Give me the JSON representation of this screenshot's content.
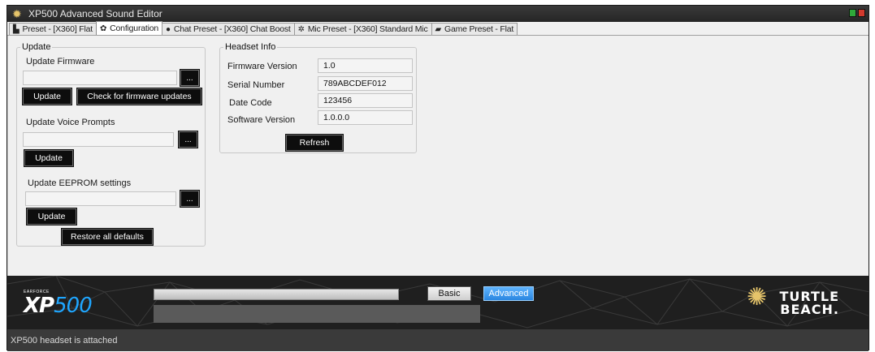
{
  "window": {
    "title": "XP500 Advanced Sound Editor",
    "icon": "turtle-beach-star-icon"
  },
  "tabs": [
    {
      "label": "Preset - [X360] Flat",
      "icon": "equalizer-icon",
      "active": false
    },
    {
      "label": "Configuration",
      "icon": "gear-icon",
      "active": true
    },
    {
      "label": "Chat Preset - [X360] Chat Boost",
      "icon": "chat-head-icon",
      "active": false
    },
    {
      "label": "Mic Preset - [X360] Standard Mic",
      "icon": "mic-settings-icon",
      "active": false
    },
    {
      "label": "Game Preset - Flat",
      "icon": "game-controller-icon",
      "active": false
    }
  ],
  "update": {
    "legend": "Update",
    "firmware_label": "Update Firmware",
    "firmware_path": "",
    "update_button": "Update",
    "check_button": "Check for firmware updates",
    "voice_label": "Update Voice Prompts",
    "voice_path": "",
    "voice_update_button": "Update",
    "eeprom_label": "Update EEPROM settings",
    "eeprom_path": "",
    "eeprom_update_button": "Update",
    "restore_button": "Restore all defaults",
    "browse_label": "..."
  },
  "headset_info": {
    "legend": "Headset Info",
    "firmware_version_label": "Firmware Version",
    "firmware_version": "1.0",
    "serial_number_label": "Serial Number",
    "serial_number": "789ABCDEF012",
    "date_code_label": "Date Code",
    "date_code": "123456",
    "software_version_label": "Software Version",
    "software_version": "1.0.0.0",
    "refresh_button": "Refresh"
  },
  "banner": {
    "logo_brand_small": "EARFORCE",
    "logo_text": "XP",
    "logo_number": "500",
    "progress": 0,
    "basic_button": "Basic",
    "advanced_button": "Advanced",
    "brand_line1": "TURTLE",
    "brand_line2": "BEACH."
  },
  "status": {
    "text": "XP500 headset is attached"
  },
  "colors": {
    "accent_blue": "#2a86e0",
    "dark_button": "#0d0d0d",
    "panel_bg": "#f0f0f0",
    "banner_bg": "#1f1f1f"
  }
}
